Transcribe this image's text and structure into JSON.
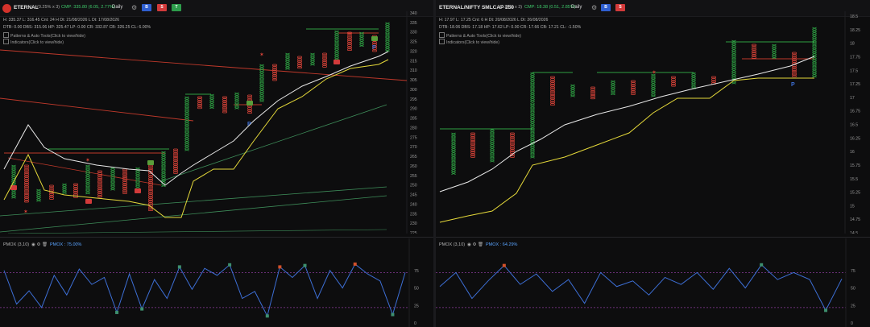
{
  "left": {
    "symbol": "ETERNAL",
    "box_info": "(0.25% x 3)",
    "cmp": "CMP: 335.80 (6.05, 2.77%)",
    "timeframe": "Daily",
    "buttons": [
      "B",
      "S",
      "T"
    ],
    "stats_row1": "H: 335.37  L: 316.45  Cnt: 24  H Dt: 21/08/2026  L Dt: 17/08/2026",
    "stats_row2": "DTB: 0.00  DBS: 315.06  HP: 325.47  LP: 0.00  CR: 332.87  CB: 326.25  CL: 6.00%",
    "patterns_label": "Patterns & Auto Tools(Click to view/hide)",
    "indicator_label": "Indicators(Click to view/hide)",
    "pmox_label": "PMOX (3,10)",
    "pmox_value": "PMOX : 75.00%",
    "price_axis": [
      "340",
      "335",
      "330",
      "325",
      "320",
      "315",
      "310",
      "305",
      "300",
      "295",
      "290",
      "285",
      "280",
      "275",
      "270",
      "265",
      "260",
      "255",
      "250",
      "245",
      "240",
      "235",
      "230",
      "225"
    ],
    "pmox_axis": [
      "75",
      "50",
      "25",
      "0"
    ],
    "pmox_values": [
      75,
      27,
      46,
      22,
      68,
      40,
      77,
      55,
      65,
      15,
      70,
      20,
      62,
      35,
      80,
      48,
      78,
      68,
      83,
      35,
      45,
      10,
      80,
      65,
      82,
      35,
      75,
      50,
      84,
      70,
      60,
      12,
      72
    ]
  },
  "right": {
    "symbol": "ETERNAL/NIFTY SMLCAP 250",
    "box_info": "(0.25% x 3)",
    "cmp": "CMP: 18.38 (0.51, 2.85%)",
    "timeframe": "Daily",
    "buttons": [
      "B",
      "S"
    ],
    "stats_row1": "H: 17.97  L: 17.25  Cnt: 6  H Dt: 20/08/2026  L Dt: 26/08/2026",
    "stats_row2": "DTB: 18.06  DBS: 17.18  HP: 17.62  LP: 0.00  CR: 17.66  CB: 17.21  CL: -1.50%",
    "patterns_label": "Patterns & Auto Tools(Click to view/hide)",
    "indicator_label": "Indicators(Click to view/hide)",
    "pmox_label": "PMOX (3,10)",
    "pmox_value": "PMOX : 64.29%",
    "price_axis": [
      "18.5",
      "18.25",
      "18",
      "17.75",
      "17.5",
      "17.25",
      "17",
      "16.75",
      "16.5",
      "16.25",
      "16",
      "15.75",
      "15.5",
      "15.25",
      "15",
      "14.75",
      "14.5"
    ],
    "pmox_axis": [
      "75",
      "50",
      "25",
      "0"
    ],
    "pmox_values": [
      52,
      72,
      35,
      60,
      82,
      55,
      70,
      45,
      62,
      28,
      72,
      52,
      60,
      40,
      65,
      55,
      72,
      48,
      78,
      50,
      83,
      62,
      72,
      62,
      18,
      63
    ]
  },
  "colors": {
    "bull": "#2ea043",
    "bear": "#e0453a",
    "white_line": "#e8e8e8",
    "yellow_line": "#e5d93a",
    "pmox_line": "#3d6fd6",
    "dashed_level": "#8a3a9a"
  }
}
